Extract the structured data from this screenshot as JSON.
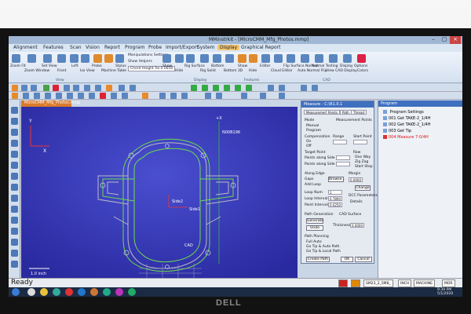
{
  "window": {
    "title": "MMinstrkit - [MicroCMM_Mfg_Photos.mmp]"
  },
  "menu": {
    "tabs": [
      "Alignment",
      "Features",
      "Scan",
      "Vision",
      "Report",
      "Program",
      "Probe",
      "Import/Export",
      "System",
      "Display",
      "Graphical Report"
    ],
    "active": "Display"
  },
  "ribbon": {
    "buttons": [
      "Zoom Fit",
      "Zoom Window",
      "Set View",
      "Front",
      "Left",
      "Iso View",
      "Probe",
      "Machine Table",
      "Stylus",
      "Show",
      "Hide",
      "Rig Surface",
      "Rig Solid",
      "Bottom",
      "Bottom 3D",
      "Show",
      "Hide",
      "Editor",
      "Cloud Editor",
      "Flip Surface Normal",
      "Auto Normal Flip",
      "Normal Testing",
      "View CAD Display",
      "Display Options",
      "Colors"
    ],
    "options": [
      "Manipulations Settings",
      "Show Helpers",
      "Chord Height Tol 0.0050"
    ],
    "groups": [
      "View",
      "Display",
      "Features",
      "CAD"
    ]
  },
  "doc_tab": "MicroCMM_Mfg_Photos.mmp",
  "viewport": {
    "axis_labels": {
      "y_top": "Y",
      "z_top": "+X",
      "x_right": "X",
      "side": "Side1",
      "side2": "Side2",
      "cad_label": "CAD"
    },
    "callout": "N00B196",
    "scale": "1.0 inch"
  },
  "measure": {
    "title": "Measure - C:\\R1.0.1",
    "tabs": [
      "Measurement",
      "Points",
      "Path",
      "Thread"
    ],
    "mode_label": "Mode",
    "mode_options": [
      "Manual",
      "Program"
    ],
    "measurement_points_label": "Measurement Points",
    "comp_label": "Compensation",
    "comp_options": [
      "On",
      "Off"
    ],
    "range_label": "Range",
    "start_point_label": "Start Point",
    "row_label": "Row",
    "target_point_label": "Target Point",
    "points_along_side1": "Points along Side 1",
    "points_along_side2": "Points along Side 2",
    "stop_options": [
      "One Way",
      "Zig Zag",
      "Start Stop"
    ],
    "along_edge_label": "Along Edge",
    "gaps_label": "Gaps",
    "add_loop_label": "Add Loop",
    "offset_label": "Offset",
    "loop_num_label": "Loop Num",
    "loop_num": "1",
    "loop_interval_label": "Loop Interval",
    "loop_interval": "0.7890",
    "point_interval_label": "Point Interval",
    "point_interval": "0.0250",
    "margin_label": "Margin",
    "margin_value": "0.0000",
    "browse_label": "Browse...",
    "change_label": "Change",
    "dcc_label": "DCC Parameters",
    "details_label": "Details",
    "path_generation_label": "Path Generation",
    "generate_label": "Generate",
    "undo_label": "Undo",
    "cad_surface_label": "CAD Surface",
    "thickness_label": "Thickness",
    "thickness_value": "0.0000",
    "path_planning_label": "Path Planning",
    "planning_options": [
      "Full Auto",
      "Go Tip & Auto Path",
      "Go Tip & Local Path"
    ],
    "create_path_label": "Create Path",
    "ok_label": "OK",
    "cancel_label": "Cancel"
  },
  "program": {
    "title": "Program",
    "items": [
      {
        "num": "",
        "text": "Program Settings",
        "red": false
      },
      {
        "num": "001",
        "text": "Get TAKE-2_1/4H",
        "red": false
      },
      {
        "num": "002",
        "text": "Get TAKE-2_1/4H",
        "red": false
      },
      {
        "num": "003",
        "text": "Get Tip",
        "red": false
      },
      {
        "num": "004",
        "text": "Measure 7-0/4H",
        "red": true
      }
    ]
  },
  "status": {
    "ready": "Ready",
    "boxes": [
      "SM23_2_SM8_",
      "INCH",
      "MACHINE",
      "MOR"
    ]
  },
  "taskbar": {
    "clock_time": "9:39 PM",
    "clock_date": "5/1/2020"
  }
}
